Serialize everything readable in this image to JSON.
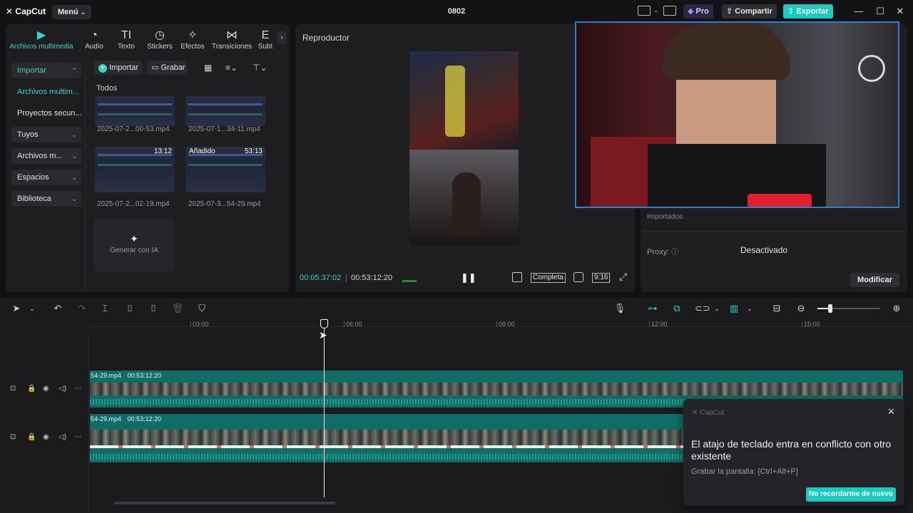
{
  "titlebar": {
    "logo": "CapCut",
    "menu": "Menú",
    "project_title": "0802",
    "pro": "Pro",
    "share": "Compartir",
    "export": "Exportar"
  },
  "media": {
    "categories": [
      {
        "label": "Archivos multimedia",
        "icon": "media-icon"
      },
      {
        "label": "Audio",
        "icon": "audio-icon"
      },
      {
        "label": "Texto",
        "icon": "text-icon"
      },
      {
        "label": "Stickers",
        "icon": "sticker-icon"
      },
      {
        "label": "Efectos",
        "icon": "effects-icon"
      },
      {
        "label": "Transiciones",
        "icon": "transitions-icon"
      },
      {
        "label": "Subt",
        "icon": "subtitles-icon"
      }
    ],
    "sidebar": [
      {
        "label": "Importar",
        "chev": "⌃"
      },
      {
        "label": "Archivos multim..."
      },
      {
        "label": "Proyectos secun..."
      },
      {
        "label": "Tuyos",
        "chev": "⌄"
      },
      {
        "label": "Archivos m...",
        "chev": "⌄"
      },
      {
        "label": "Espacios",
        "chev": "⌄"
      },
      {
        "label": "Biblioteca",
        "chev": "⌄"
      }
    ],
    "import_button": "Importar",
    "record_button": "Grabar",
    "section_label": "Todos",
    "thumbs": [
      {
        "name": "2025-07-2...00-53.mp4",
        "tag": ""
      },
      {
        "name": "2025-07-1...34-11.mp4",
        "tag": ""
      },
      {
        "name": "2025-07-2...02-19.mp4",
        "tag": "13:12"
      },
      {
        "name": "2025-07-3...54-29.mp4",
        "tag": "Añadido",
        "duration": "53:13"
      }
    ],
    "ai_generate": "Generar con IA"
  },
  "player": {
    "title": "Reproductor",
    "current_time": "00:05:37:02",
    "total_time": "00:53:12:20",
    "full_label": "Completa",
    "ratio_label": "9:16"
  },
  "props": {
    "imported_label": "Importados",
    "proxy_label": "Proxy:",
    "proxy_value": "Desactivado",
    "modify_button": "Modificar"
  },
  "timeline": {
    "ruler": [
      "03:00",
      "06:00",
      "09:00",
      "12:00",
      "15:00"
    ],
    "tracks": [
      {
        "clip_name": "54-29.mp4",
        "clip_duration": "00:53:12:20"
      },
      {
        "clip_name": "54-29.mp4",
        "clip_duration": "00:53:12:20"
      }
    ]
  },
  "toast": {
    "app": "CapCut",
    "title": "El atajo de teclado entra en conflicto con otro existente",
    "detail": "Grabar la pantalla: [Ctrl+Alt+P]",
    "button": "No recordarme de nuevo"
  },
  "colors": {
    "accent": "#35d3c8",
    "clip": "#0f6d66",
    "export": "#1fc9c0"
  }
}
